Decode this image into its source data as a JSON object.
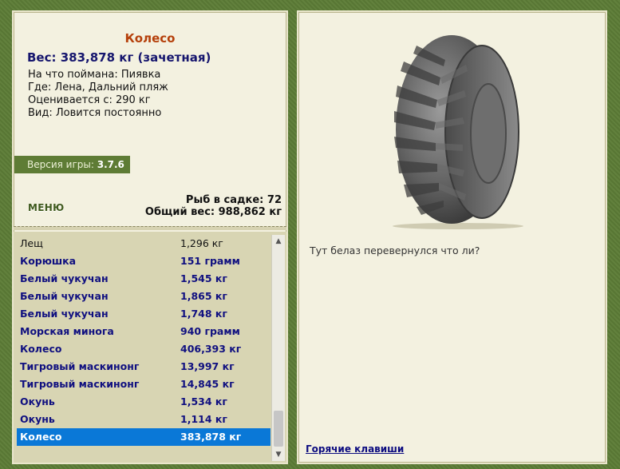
{
  "catch": {
    "title": "Колесо",
    "weight": "Вес: 383,878 кг (зачетная)",
    "bait": "На что поймана: Пиявка",
    "place": "Где: Лена, Дальний пляж",
    "rated": "Оценивается с: 290 кг",
    "kind": "Вид: Ловится постоянно",
    "comment": "Тут белаз перевернулся что ли?"
  },
  "version": {
    "label": "Версия игры:",
    "value": "3.7.6"
  },
  "menu_label": "МЕНЮ",
  "keepnet": {
    "fish_count": "Рыб в садке: 72",
    "total_weight": "Общий вес: 988,862 кг"
  },
  "catch_list": [
    {
      "name": "Лещ",
      "weight": "1,296 кг",
      "style": "normal"
    },
    {
      "name": "Корюшка",
      "weight": "151 грамм",
      "style": "bold"
    },
    {
      "name": "Белый чукучан",
      "weight": "1,545 кг",
      "style": "bold"
    },
    {
      "name": "Белый чукучан",
      "weight": "1,865 кг",
      "style": "bold"
    },
    {
      "name": "Белый чукучан",
      "weight": "1,748 кг",
      "style": "bold"
    },
    {
      "name": "Морская минога",
      "weight": "940 грамм",
      "style": "bold"
    },
    {
      "name": "Колесо",
      "weight": "406,393 кг",
      "style": "bold"
    },
    {
      "name": "Тигровый маскинонг",
      "weight": "13,997 кг",
      "style": "bold"
    },
    {
      "name": "Тигровый маскинонг",
      "weight": "14,845 кг",
      "style": "bold"
    },
    {
      "name": "Окунь",
      "weight": "1,534 кг",
      "style": "bold"
    },
    {
      "name": "Окунь",
      "weight": "1,114 кг",
      "style": "bold"
    },
    {
      "name": "Колесо",
      "weight": "383,878 кг",
      "style": "selected"
    }
  ],
  "hotkeys_label": "Горячие клавиши",
  "icons": {
    "scroll_up": "arrow-up-icon",
    "scroll_down": "arrow-down-icon",
    "catch_image": "tire-image"
  },
  "colors": {
    "frame": "#5d7d37",
    "panel": "#f3f1e0",
    "title": "#b5400b",
    "accent_text": "#16166e",
    "selection": "#0a78d7"
  }
}
